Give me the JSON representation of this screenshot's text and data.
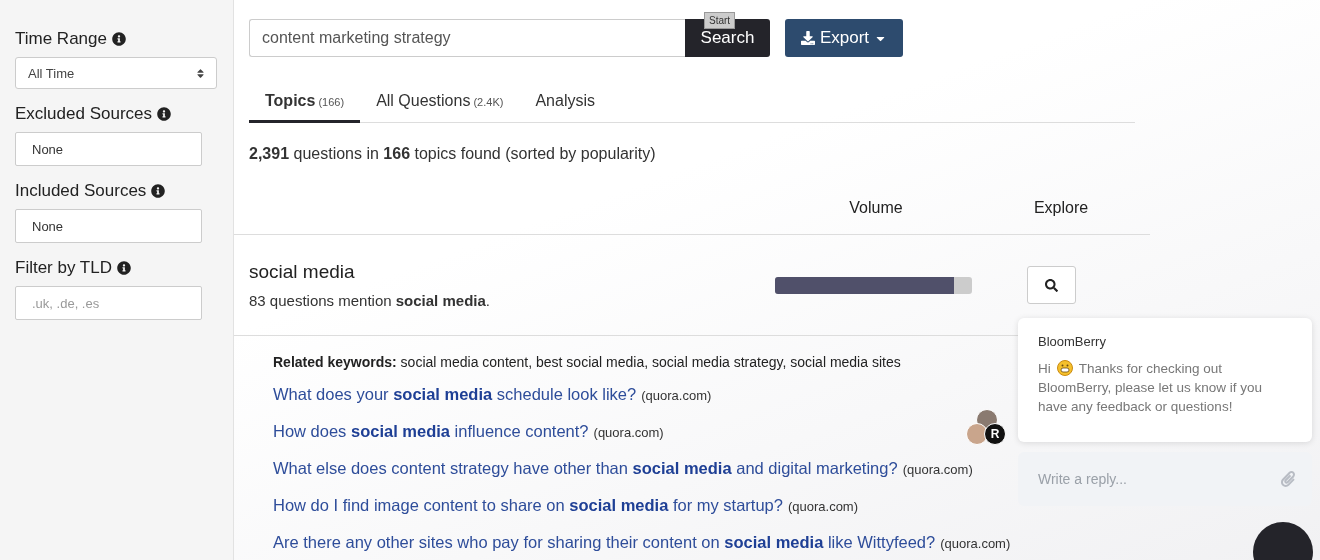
{
  "sidebar": {
    "filters": [
      {
        "label": "Time Range",
        "kind": "select",
        "value": "All Time"
      },
      {
        "label": "Excluded Sources",
        "kind": "input",
        "value": "None"
      },
      {
        "label": "Included Sources",
        "kind": "input",
        "value": "None"
      },
      {
        "label": "Filter by TLD",
        "kind": "input",
        "placeholder": ".uk, .de, .es"
      }
    ]
  },
  "search": {
    "value": "content marketing strategy",
    "button": "Search",
    "tooltip": "Start"
  },
  "export_button": "Export",
  "tabs": [
    {
      "label": "Topics",
      "count": "(166)",
      "selected": true
    },
    {
      "label": "All Questions",
      "count": "(2.4K)",
      "selected": false
    },
    {
      "label": "Analysis",
      "selected": false
    }
  ],
  "summary": "**2,391** questions in **166** topics found (sorted by popularity)",
  "columns": [
    "Volume",
    "Explore"
  ],
  "topic": {
    "title": "social media",
    "mention": "83 questions mention **social media**.",
    "level": 0.91
  },
  "related": {
    "label": "Related keywords:",
    "text": "social media content, best social media, social media strategy, social media sites"
  },
  "questions": [
    {
      "text": "What does your **social media** schedule look like?",
      "source": "(quora.com)"
    },
    {
      "text": "How does **social media** influence content?",
      "source": "(quora.com)"
    },
    {
      "text": "What else does content strategy have other than **social media** and digital marketing?",
      "source": "(quora.com)"
    },
    {
      "text": "How do I find image content to share on **social media** for my startup?",
      "source": "(quora.com)"
    },
    {
      "text": "Are there any other sites who pay for sharing their content on **social media** like Wittyfeed?",
      "source": "(quora.com)"
    }
  ],
  "chat": {
    "sender": "BloomBerry",
    "greeting": "Hi",
    "message": "Thanks for checking out BloomBerry, please let us know if you have any feedback or questions!",
    "placeholder": "Write a reply...",
    "avatar_letter": "R"
  }
}
